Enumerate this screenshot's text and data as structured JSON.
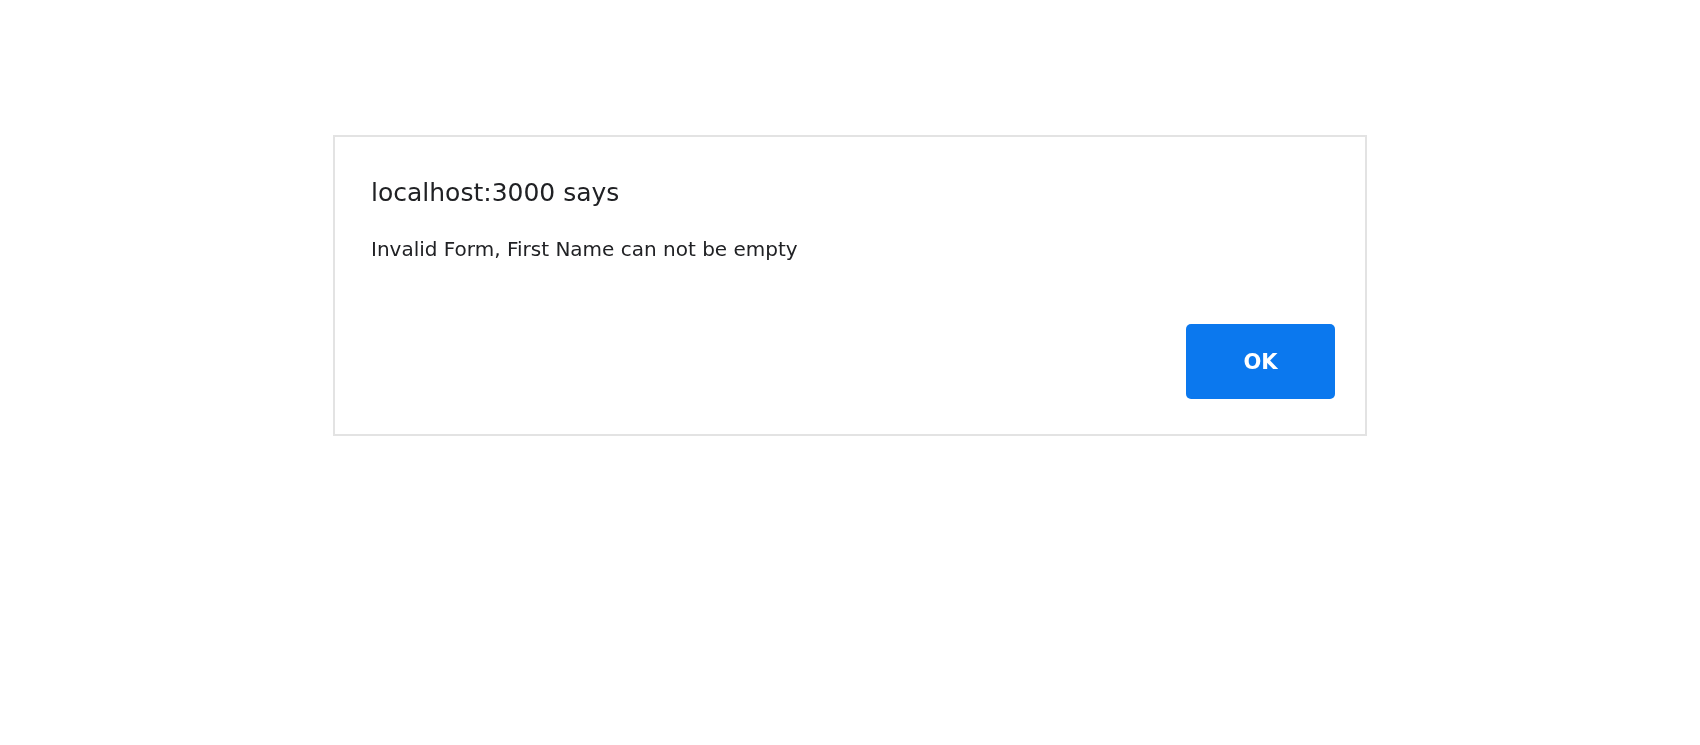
{
  "dialog": {
    "title": "localhost:3000 says",
    "message": "Invalid Form, First Name can not be empty",
    "buttons": [
      "OK"
    ]
  }
}
